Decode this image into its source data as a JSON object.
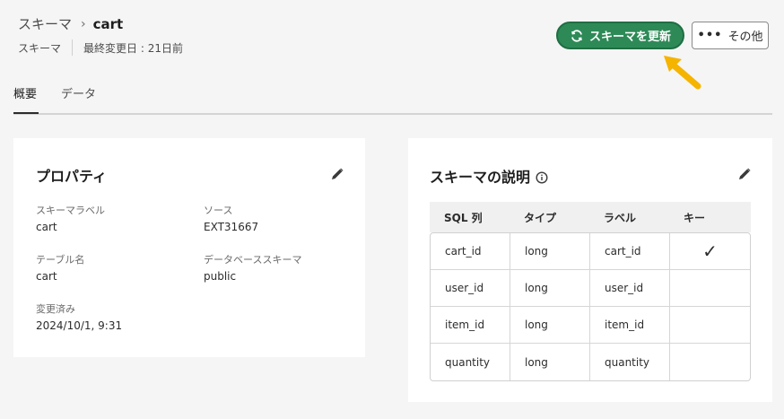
{
  "breadcrumb": {
    "parent": "スキーマ",
    "separator": "›",
    "current": "cart"
  },
  "meta": {
    "type": "スキーマ",
    "modified": "最終変更日 : 21日前"
  },
  "actions": {
    "refresh_label": "スキーマを更新",
    "more_label": "その他",
    "more_dots": "•••"
  },
  "tabs": [
    {
      "label": "概要"
    },
    {
      "label": "データ"
    }
  ],
  "properties": {
    "title": "プロパティ",
    "schema_label": {
      "label": "スキーマラベル",
      "value": "cart"
    },
    "source": {
      "label": "ソース",
      "value": "EXT31667"
    },
    "table_name": {
      "label": "テーブル名",
      "value": "cart"
    },
    "db_schema": {
      "label": "データベーススキーマ",
      "value": "public"
    },
    "modified": {
      "label": "変更済み",
      "value": "2024/10/1, 9:31"
    }
  },
  "schema_desc": {
    "title": "スキーマの説明",
    "columns": [
      "SQL 列",
      "タイプ",
      "ラベル",
      "キー"
    ],
    "rows": [
      {
        "sql": "cart_id",
        "type": "long",
        "label": "cart_id",
        "key": "✓"
      },
      {
        "sql": "user_id",
        "type": "long",
        "label": "user_id",
        "key": ""
      },
      {
        "sql": "item_id",
        "type": "long",
        "label": "item_id",
        "key": ""
      },
      {
        "sql": "quantity",
        "type": "long",
        "label": "quantity",
        "key": ""
      }
    ]
  },
  "colors": {
    "primary": "#2d8a57",
    "arrow": "#f5b400"
  }
}
